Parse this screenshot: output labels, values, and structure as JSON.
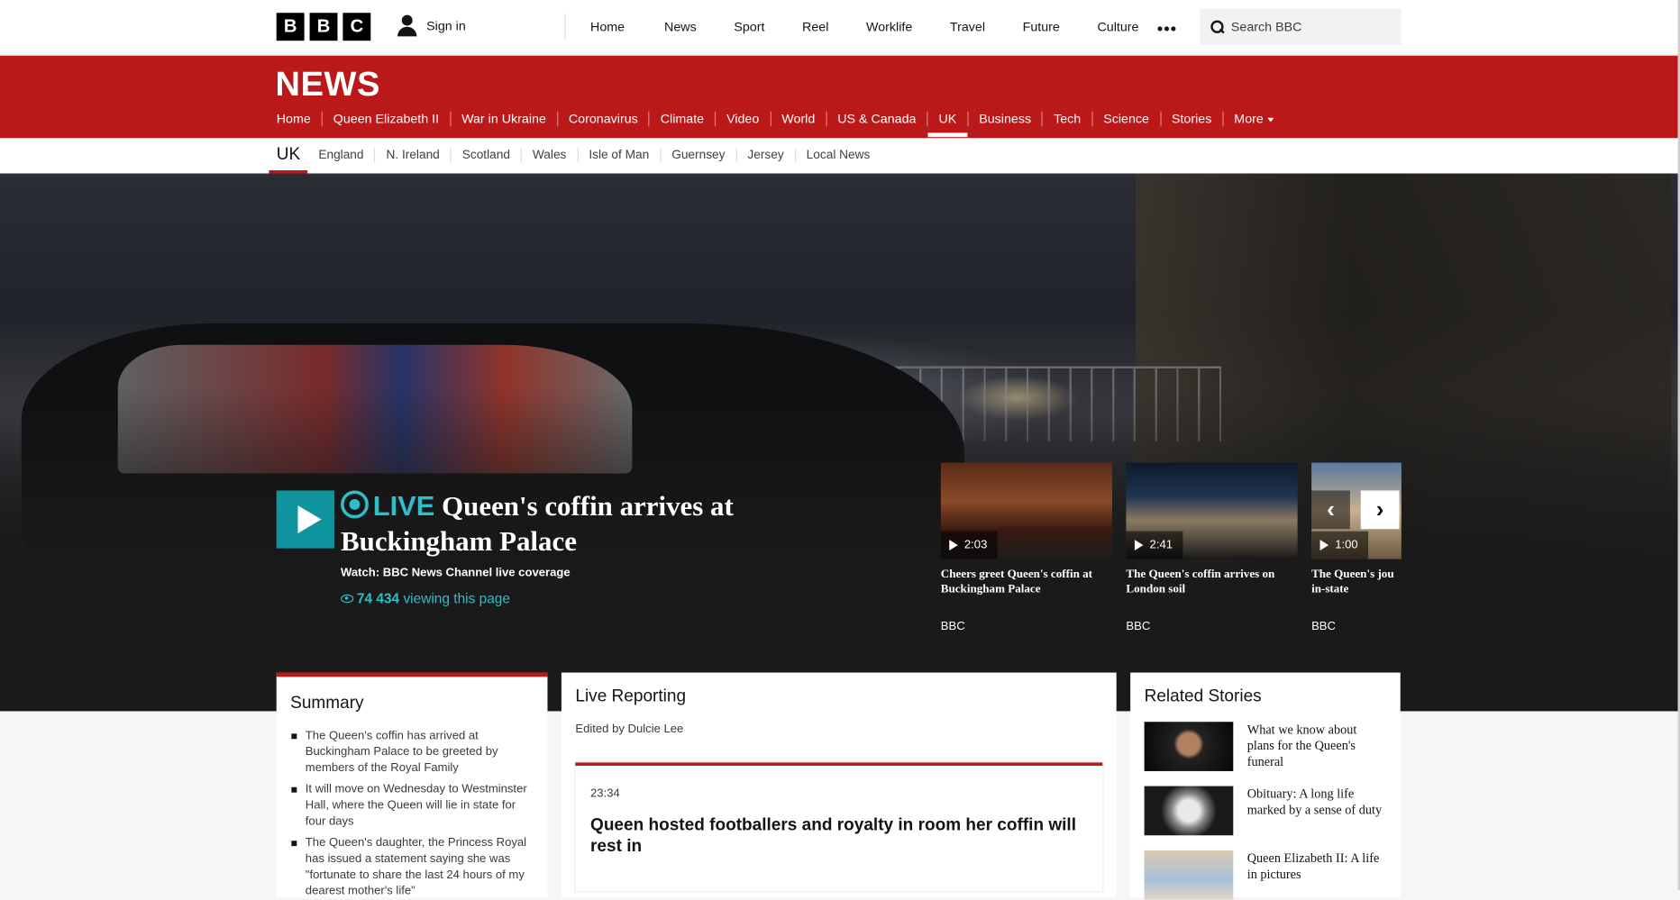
{
  "header": {
    "logo": [
      "B",
      "B",
      "C"
    ],
    "signin": "Sign in",
    "nav": [
      "Home",
      "News",
      "Sport",
      "Reel",
      "Worklife",
      "Travel",
      "Future",
      "Culture"
    ],
    "more_icon": "more-dots-icon",
    "search_placeholder": "Search BBC"
  },
  "news_nav": {
    "title": "NEWS",
    "items": [
      "Home",
      "Queen Elizabeth II",
      "War in Ukraine",
      "Coronavirus",
      "Climate",
      "Video",
      "World",
      "US & Canada",
      "UK",
      "Business",
      "Tech",
      "Science",
      "Stories"
    ],
    "active": "UK",
    "more": "More"
  },
  "sub_nav": {
    "current": "UK",
    "items": [
      "England",
      "N. Ireland",
      "Scotland",
      "Wales",
      "Isle of Man",
      "Guernsey",
      "Jersey",
      "Local News"
    ]
  },
  "hero": {
    "live_label": "LIVE",
    "headline": "Queen's coffin arrives at Buckingham Palace",
    "watch": "Watch: BBC News Channel live coverage",
    "viewers": "74 434",
    "viewing_text": "viewing this page"
  },
  "videos": [
    {
      "duration": "2:03",
      "title": "Cheers greet Queen's coffin at Buckingham Palace",
      "source": "BBC"
    },
    {
      "duration": "2:41",
      "title": "The Queen's coffin arrives on London soil",
      "source": "BBC"
    },
    {
      "duration": "1:00",
      "title": "The Queen's jou in-state",
      "source": "BBC"
    }
  ],
  "summary": {
    "title": "Summary",
    "items": [
      "The Queen's coffin has arrived at Buckingham Palace to be greeted by members of the Royal Family",
      "It will move on Wednesday to Westminster Hall, where the Queen will lie in state for four days",
      "The Queen's daughter, the Princess Royal has issued a statement saying she was \"fortunate to share the last 24 hours of my dearest mother's life\""
    ]
  },
  "live_reporting": {
    "title": "Live Reporting",
    "edited_by": "Edited by Dulcie Lee",
    "post": {
      "time": "23:34",
      "title": "Queen hosted footballers and royalty in room her coffin will rest in"
    }
  },
  "related": {
    "title": "Related Stories",
    "items": [
      "What we know about plans for the Queen's funeral",
      "Obituary: A long life marked by a sense of duty",
      "Queen Elizabeth II: A life in pictures"
    ]
  },
  "colors": {
    "bbc_red": "#bb1919",
    "live_teal": "#2fbec8",
    "play_teal": "#0f939c"
  }
}
